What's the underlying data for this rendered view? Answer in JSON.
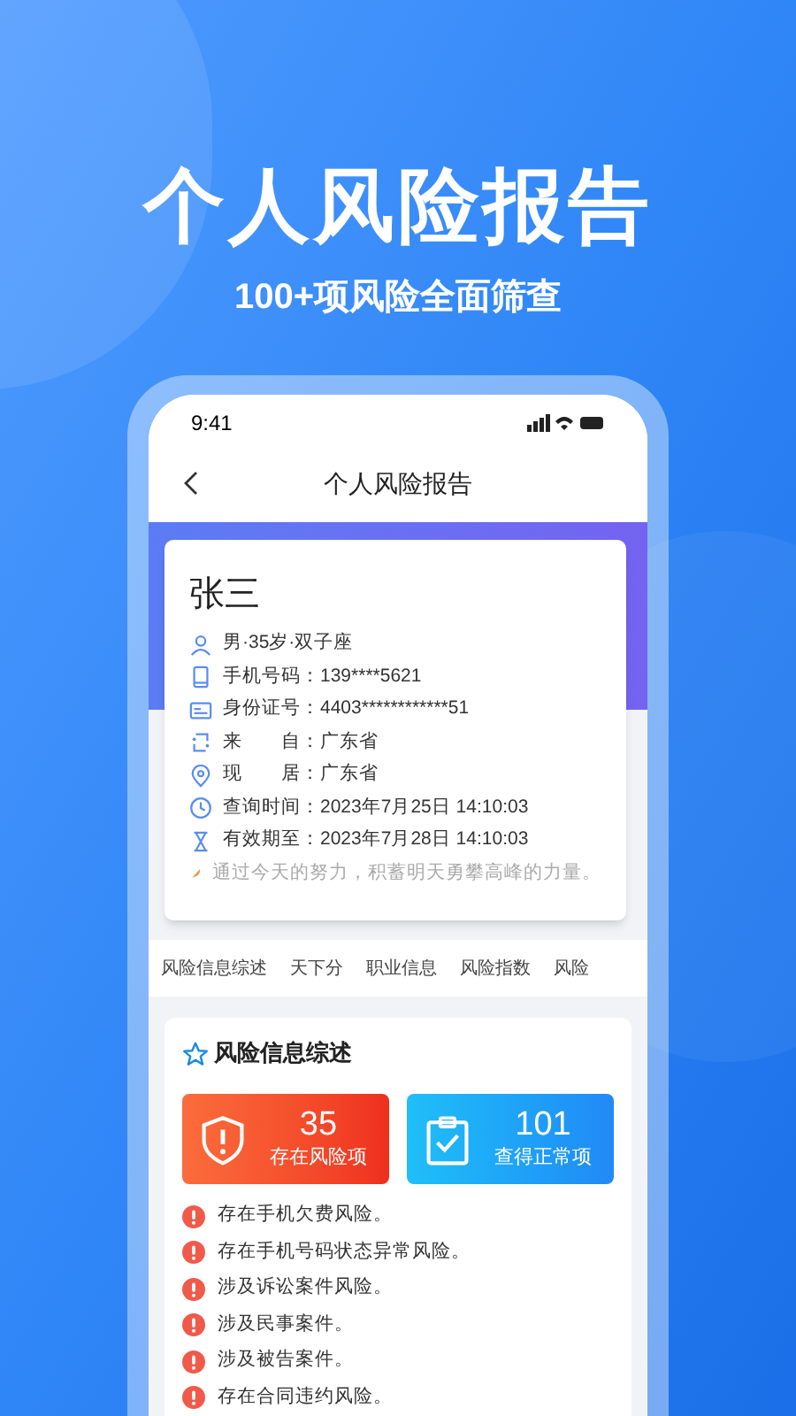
{
  "headline": "个人风险报告",
  "subheadline": "100+项风险全面筛查",
  "status_bar": {
    "time": "9:41"
  },
  "nav": {
    "title": "个人风险报告"
  },
  "profile": {
    "name": "张三",
    "rows": [
      {
        "kind": "person",
        "text": "男·35岁·双子座"
      },
      {
        "kind": "phone",
        "label": "手机号码：",
        "value": "139****5621"
      },
      {
        "kind": "id",
        "label": "身份证号：",
        "value": "4403************51"
      },
      {
        "kind": "origin",
        "label": "来　　自：",
        "value": "广东省"
      },
      {
        "kind": "location",
        "label": "现　　居：",
        "value": "广东省"
      },
      {
        "kind": "clock",
        "label": "查询时间：",
        "value": "2023年7月25日 14:10:03"
      },
      {
        "kind": "hourglass",
        "label": "有效期至：",
        "value": "2023年7月28日 14:10:03"
      },
      {
        "kind": "motto",
        "text": "通过今天的努力，积蓄明天勇攀高峰的力量。"
      }
    ]
  },
  "tabs": [
    {
      "label": "风险信息综述"
    },
    {
      "label": "天下分"
    },
    {
      "label": "职业信息"
    },
    {
      "label": "风险指数"
    },
    {
      "label": "风险"
    }
  ],
  "section": {
    "title": "风险信息综述",
    "stats": [
      {
        "kind": "risk",
        "count": "35",
        "label": "存在风险项"
      },
      {
        "kind": "normal",
        "count": "101",
        "label": "查得正常项"
      }
    ],
    "risks": [
      "存在手机欠费风险。",
      "存在手机号码状态异常风险。",
      "涉及诉讼案件风险。",
      "涉及民事案件。",
      "涉及被告案件。",
      "存在合同违约风险。"
    ]
  }
}
